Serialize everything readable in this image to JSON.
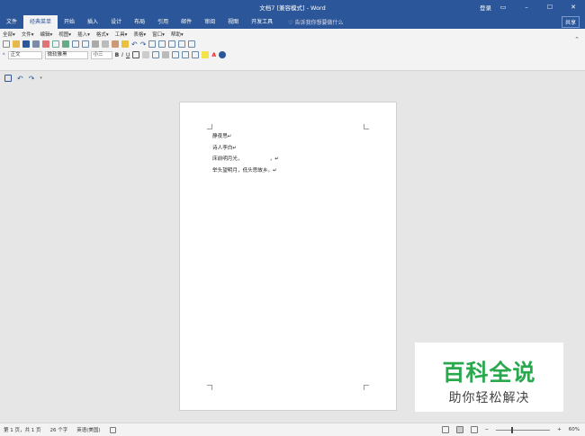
{
  "window": {
    "title": "文档7 [兼容模式] - Word",
    "login": "登录",
    "controls": [
      "▭",
      "–",
      "☐",
      "✕"
    ]
  },
  "tabs": [
    "文件",
    "经典菜单",
    "开始",
    "插入",
    "设计",
    "布局",
    "引用",
    "邮件",
    "审阅",
    "视图",
    "开发工具"
  ],
  "active_tab": "经典菜单",
  "tell_me": "♡ 告诉我你想要做什么",
  "share": "共享",
  "menu": [
    "全部▾",
    "文件▾",
    "编辑▾",
    "视图▾",
    "插入▾",
    "格式▾",
    "工具▾",
    "表格▾",
    "窗口▾",
    "帮助▾"
  ],
  "format": {
    "style": "正文",
    "font": "微软雅黑",
    "size": "小三"
  },
  "document": {
    "lines": [
      "静夜思↵",
      "诗人李白↵",
      "床前明月光，                 ，↵",
      "举头望明月，低头思故乡。↵"
    ]
  },
  "watermark": {
    "line1": "百科全说",
    "line2": "助你轻松解决"
  },
  "status": {
    "page": "第 1 页，共 1 页",
    "words": "26 个字",
    "lang": "英语(美国)",
    "zoom": "60%"
  },
  "colors": {
    "accent": "#2b579a",
    "watermark": "#2aa84e"
  }
}
